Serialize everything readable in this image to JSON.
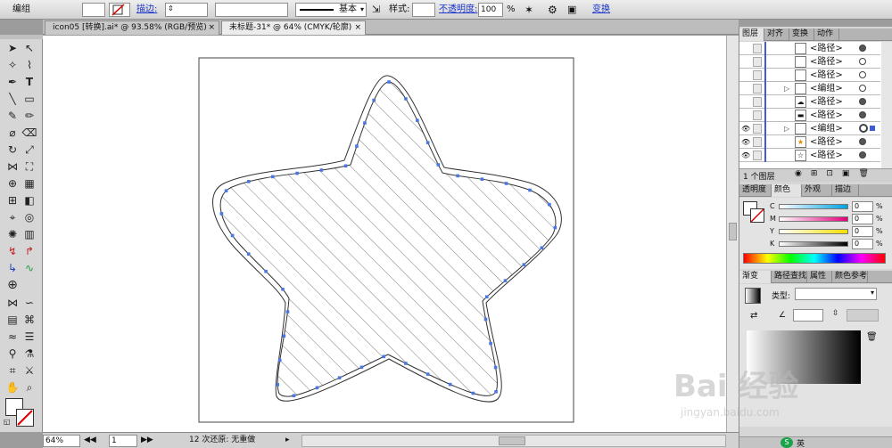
{
  "control_bar": {
    "selection_label": "编组",
    "stroke_link": "描边:",
    "brush_label": "基本",
    "style_label": "样式:",
    "opacity_link": "不透明度:",
    "opacity_value": "100",
    "opacity_unit": "%",
    "transform_link": "变换"
  },
  "tabs": [
    {
      "label": "icon05 [转换].ai* @ 93.58% (RGB/预览)",
      "close": "×"
    },
    {
      "label": "未标题-31* @ 64% (CMYK/轮廓)",
      "close": "×"
    }
  ],
  "status_bar": {
    "zoom": "64%",
    "page": "1",
    "undo_text": "12 次还原: 无重做"
  },
  "layers_panel": {
    "tabs": [
      "图层",
      "对齐",
      "变换",
      "动作"
    ],
    "rows": [
      {
        "name": "<路径>",
        "eye": false
      },
      {
        "name": "<路径>",
        "eye": false
      },
      {
        "name": "<路径>",
        "eye": false
      },
      {
        "name": "<编组>",
        "eye": false
      },
      {
        "name": "<路径>",
        "eye": false
      },
      {
        "name": "<路径>",
        "eye": false
      },
      {
        "name": "<编组>",
        "eye": true
      },
      {
        "name": "<路径>",
        "eye": true
      },
      {
        "name": "<路径>",
        "eye": true
      }
    ],
    "footer": "1 个图层"
  },
  "color_panel": {
    "tabs": [
      "透明度",
      "颜色",
      "外观",
      "描边"
    ],
    "channels": [
      {
        "name": "C",
        "value": "0",
        "unit": "%",
        "color": "#00a0e0"
      },
      {
        "name": "M",
        "value": "0",
        "unit": "%",
        "color": "#e0007a"
      },
      {
        "name": "Y",
        "value": "0",
        "unit": "%",
        "color": "#f5e000"
      },
      {
        "name": "K",
        "value": "0",
        "unit": "%",
        "color": "#000000"
      }
    ]
  },
  "gradient_panel": {
    "tabs": [
      "渐变",
      "路径查找",
      "属性",
      "颜色参考"
    ],
    "type_label": "类型:"
  },
  "watermark": {
    "brand": "Bai 经验",
    "url": "jingyan.baidu.com"
  },
  "taskbar": {
    "ime": "英"
  },
  "colors": {
    "anchor": "#4a78e0",
    "accent_link": "#1b36c8"
  }
}
